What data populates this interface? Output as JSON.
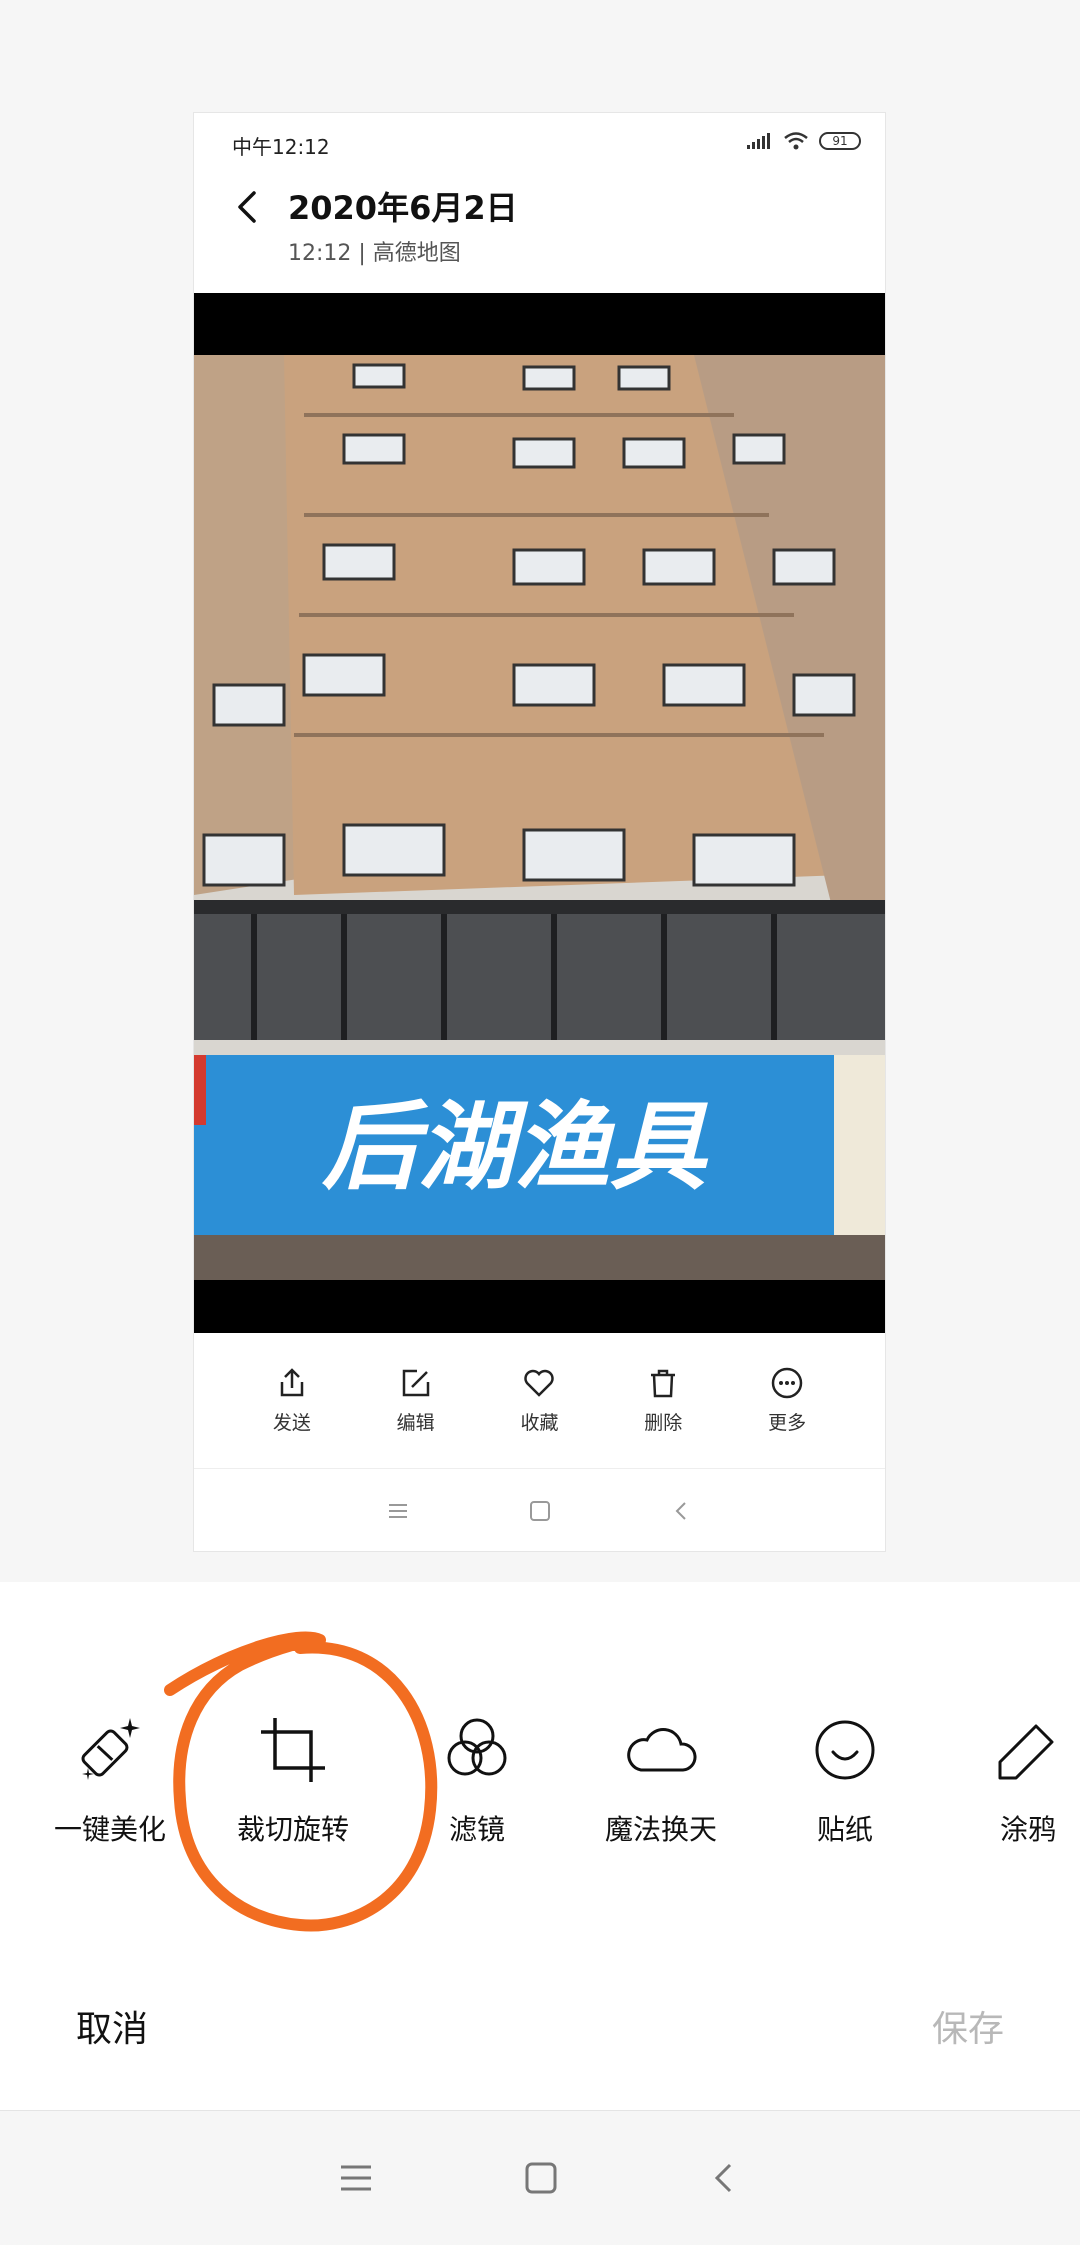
{
  "inner_screen": {
    "status_time": "中午12:12",
    "battery": "91",
    "photo_date": "2020年6月2日",
    "photo_sub": "12:12 | 高德地图",
    "photo_sign_text": "后湖渔具",
    "actions": [
      {
        "label": "发送",
        "icon": "share-icon"
      },
      {
        "label": "编辑",
        "icon": "edit-icon"
      },
      {
        "label": "收藏",
        "icon": "heart-icon"
      },
      {
        "label": "删除",
        "icon": "trash-icon"
      },
      {
        "label": "更多",
        "icon": "more-icon"
      }
    ]
  },
  "editor": {
    "tools": [
      {
        "label": "一键美化",
        "icon": "magic-eraser-icon"
      },
      {
        "label": "裁切旋转",
        "icon": "crop-icon"
      },
      {
        "label": "滤镜",
        "icon": "filter-circles-icon"
      },
      {
        "label": "魔法换天",
        "icon": "cloud-icon"
      },
      {
        "label": "贴纸",
        "icon": "smiley-icon"
      },
      {
        "label": "涂鸦",
        "icon": "pen-icon"
      }
    ],
    "cancel_label": "取消",
    "save_label": "保存"
  },
  "colors": {
    "accent_circle": "#f26d21",
    "sign_blue": "#2c8fd6",
    "building_tan": "#c8a27e"
  }
}
